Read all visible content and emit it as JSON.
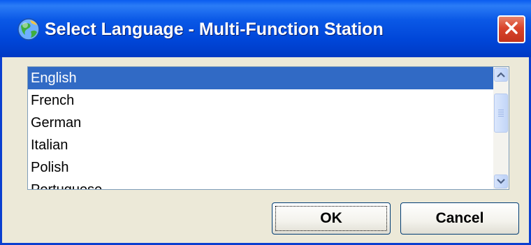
{
  "window": {
    "title": "Select Language - Multi-Function Station",
    "icon": "globe-icon",
    "close_icon": "close-icon"
  },
  "languages": {
    "selected": "English",
    "items": [
      "English",
      "French",
      "German",
      "Italian",
      "Polish",
      "Portuguese"
    ]
  },
  "buttons": {
    "ok_label": "OK",
    "cancel_label": "Cancel"
  },
  "colors": {
    "titlebar": "#0046d8",
    "selection": "#316ac5",
    "dialog_bg": "#ece9d8",
    "close_button": "#d9442b"
  }
}
